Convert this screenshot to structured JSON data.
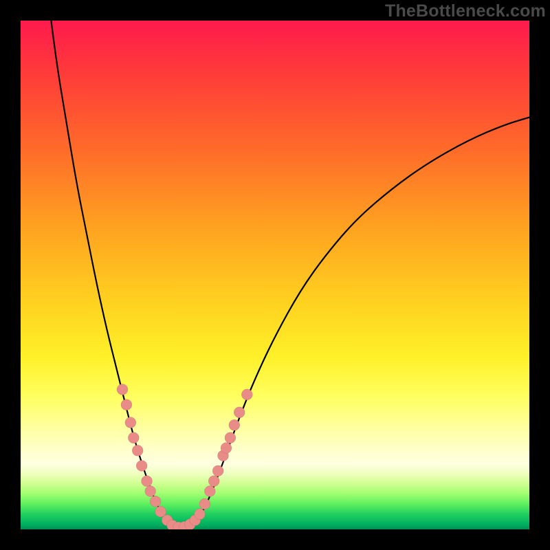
{
  "watermark": "TheBottleneck.com",
  "chart_data": {
    "type": "line",
    "title": "",
    "xlabel": "",
    "ylabel": "",
    "xlim": [
      0,
      100
    ],
    "ylim": [
      0,
      100
    ],
    "grid": false,
    "legend": false,
    "curve_points": [
      {
        "x": 6.0,
        "y": 100.0
      },
      {
        "x": 7.0,
        "y": 92.0
      },
      {
        "x": 9.0,
        "y": 80.0
      },
      {
        "x": 11.0,
        "y": 68.0
      },
      {
        "x": 13.0,
        "y": 58.0
      },
      {
        "x": 15.0,
        "y": 48.0
      },
      {
        "x": 17.0,
        "y": 39.0
      },
      {
        "x": 19.0,
        "y": 31.0
      },
      {
        "x": 20.5,
        "y": 25.0
      },
      {
        "x": 22.0,
        "y": 19.0
      },
      {
        "x": 23.5,
        "y": 14.0
      },
      {
        "x": 25.0,
        "y": 9.5
      },
      {
        "x": 26.5,
        "y": 5.5
      },
      {
        "x": 28.0,
        "y": 2.5
      },
      {
        "x": 29.5,
        "y": 0.8
      },
      {
        "x": 31.0,
        "y": 0.3
      },
      {
        "x": 32.5,
        "y": 0.4
      },
      {
        "x": 34.0,
        "y": 1.2
      },
      {
        "x": 35.5,
        "y": 3.0
      },
      {
        "x": 37.0,
        "y": 6.0
      },
      {
        "x": 39.0,
        "y": 11.0
      },
      {
        "x": 41.0,
        "y": 16.5
      },
      {
        "x": 43.0,
        "y": 22.0
      },
      {
        "x": 46.0,
        "y": 29.5
      },
      {
        "x": 50.0,
        "y": 38.0
      },
      {
        "x": 55.0,
        "y": 47.0
      },
      {
        "x": 60.0,
        "y": 54.0
      },
      {
        "x": 66.0,
        "y": 61.0
      },
      {
        "x": 73.0,
        "y": 67.0
      },
      {
        "x": 80.0,
        "y": 72.0
      },
      {
        "x": 88.0,
        "y": 76.5
      },
      {
        "x": 95.0,
        "y": 79.5
      },
      {
        "x": 100.0,
        "y": 81.0
      }
    ],
    "markers": [
      {
        "x": 20.0,
        "y": 27.5
      },
      {
        "x": 20.8,
        "y": 24.5
      },
      {
        "x": 21.6,
        "y": 21.0
      },
      {
        "x": 22.2,
        "y": 18.0
      },
      {
        "x": 23.0,
        "y": 15.5
      },
      {
        "x": 23.8,
        "y": 12.5
      },
      {
        "x": 24.8,
        "y": 9.5
      },
      {
        "x": 25.5,
        "y": 7.5
      },
      {
        "x": 26.5,
        "y": 5.5
      },
      {
        "x": 27.5,
        "y": 3.5
      },
      {
        "x": 28.8,
        "y": 1.8
      },
      {
        "x": 29.8,
        "y": 0.8
      },
      {
        "x": 31.0,
        "y": 0.4
      },
      {
        "x": 32.2,
        "y": 0.5
      },
      {
        "x": 33.3,
        "y": 1.0
      },
      {
        "x": 34.3,
        "y": 1.8
      },
      {
        "x": 35.2,
        "y": 3.0
      },
      {
        "x": 36.2,
        "y": 5.0
      },
      {
        "x": 37.2,
        "y": 7.5
      },
      {
        "x": 38.0,
        "y": 9.5
      },
      {
        "x": 38.8,
        "y": 11.5
      },
      {
        "x": 39.8,
        "y": 14.5
      },
      {
        "x": 40.4,
        "y": 16.0
      },
      {
        "x": 41.2,
        "y": 18.0
      },
      {
        "x": 42.0,
        "y": 20.5
      },
      {
        "x": 43.0,
        "y": 23.0
      },
      {
        "x": 44.5,
        "y": 26.5
      }
    ],
    "colors": {
      "curve": "#000000",
      "marker": "#e98b87",
      "gradient_top": "#ff1a4d",
      "gradient_bottom": "#009050"
    }
  }
}
